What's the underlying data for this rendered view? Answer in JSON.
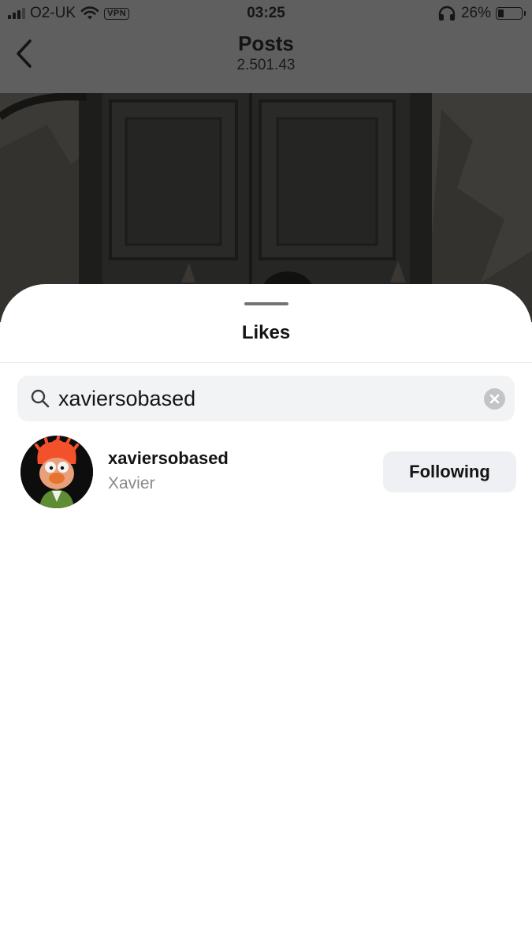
{
  "status_bar": {
    "carrier": "O2-UK",
    "vpn": "VPN",
    "time": "03:25",
    "battery": "26%",
    "battery_level": 0.26,
    "icons": [
      "signal-icon",
      "wifi-icon",
      "headphones-icon",
      "battery-icon"
    ]
  },
  "nav": {
    "title": "Posts",
    "subtitle": "2.501.43",
    "back_icon": "chevron-left-icon"
  },
  "sheet": {
    "title": "Likes",
    "search": {
      "value": "xaviersobased",
      "icon": "search-icon",
      "clear_icon": "clear-icon"
    },
    "users": [
      {
        "username": "xaviersobased",
        "name": "Xavier",
        "button_label": "Following"
      }
    ]
  },
  "colors": {
    "overlay": "#5f5f5f",
    "sheet_bg": "#ffffff",
    "search_bg": "#f2f3f5",
    "button_bg": "#eff0f3",
    "secondary_text": "#8a8a8e",
    "avatar_accent": "#f2512b"
  }
}
